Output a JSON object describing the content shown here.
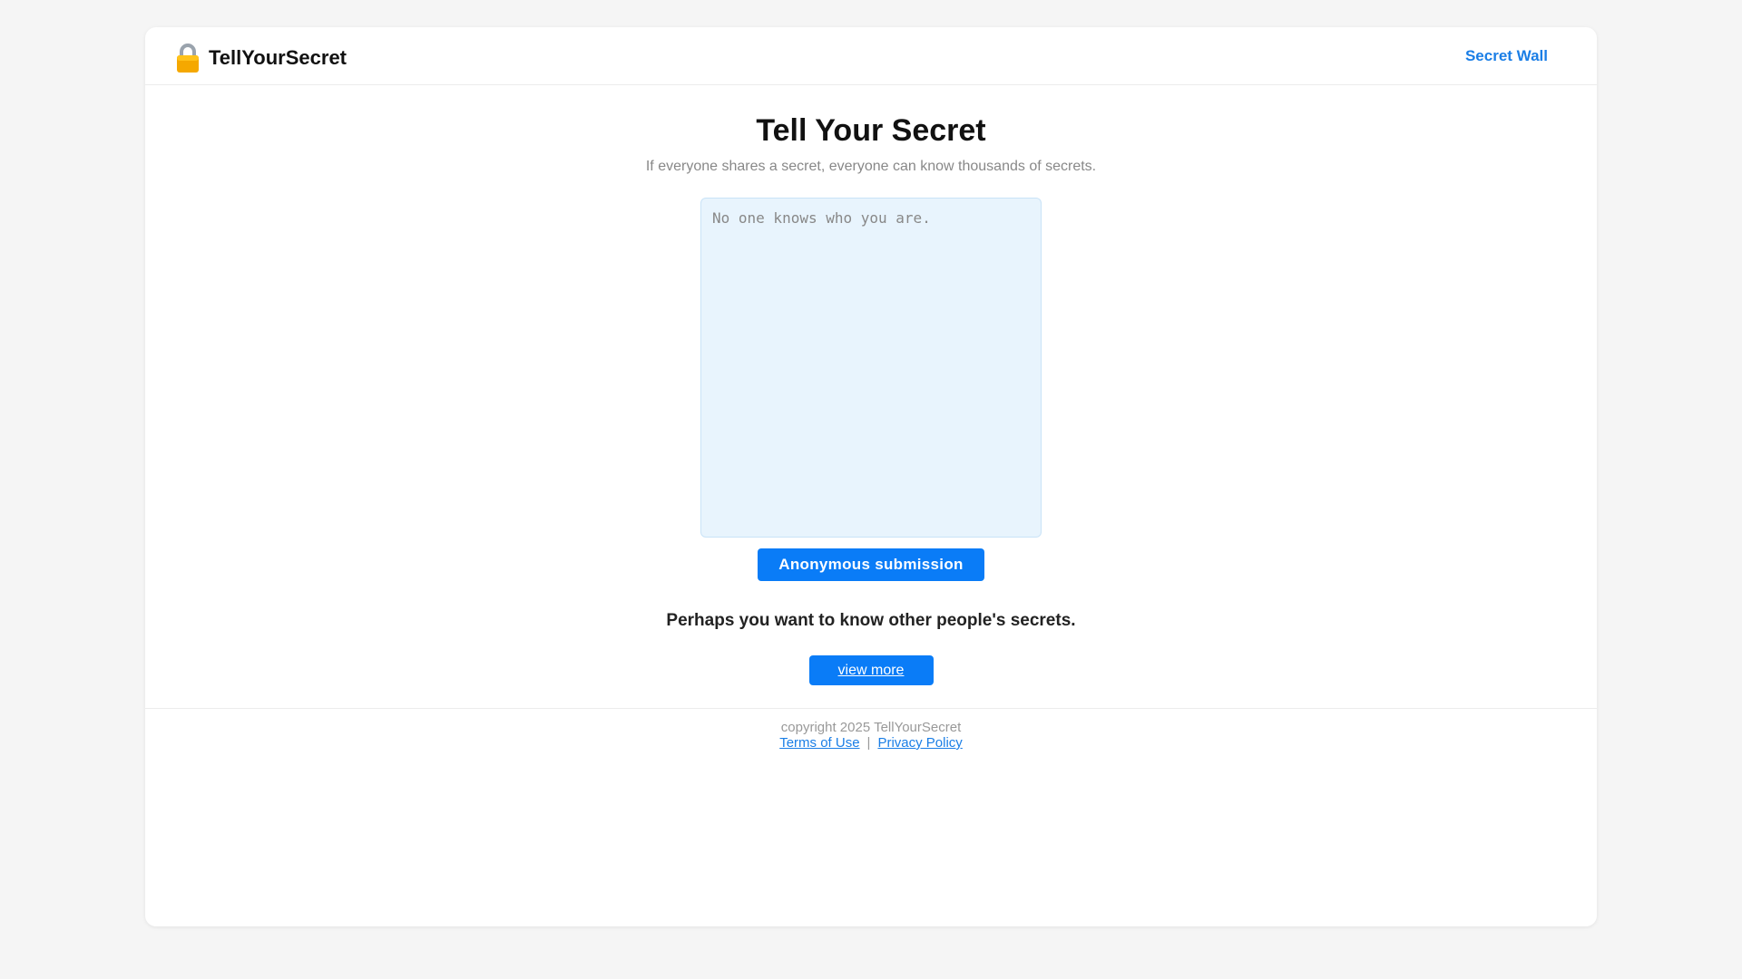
{
  "header": {
    "brand_name": "TellYourSecret",
    "nav_link": "Secret Wall"
  },
  "main": {
    "title": "Tell Your Secret",
    "subtitle": "If everyone shares a secret, everyone can know thousands of secrets.",
    "textarea_placeholder": "No one knows who you are.",
    "submit_label": "Anonymous submission",
    "prompt": "Perhaps you want to know other people's secrets.",
    "view_more_label": "view more"
  },
  "footer": {
    "copyright": "copyright 2025 TellYourSecret",
    "terms_label": "Terms of Use",
    "separator": "|",
    "privacy_label": "Privacy Policy"
  },
  "icons": {
    "brand_icon": "lock-icon"
  },
  "colors": {
    "accent": "#0a7cf7",
    "link": "#1a7ee6",
    "textarea_bg": "#e8f4fd",
    "lock_body": "#f5a800",
    "lock_shackle": "#9aa3ad"
  }
}
